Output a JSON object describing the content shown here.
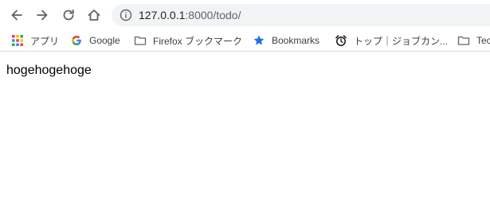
{
  "browser": {
    "address_bar": {
      "host": "127.0.0.1",
      "rest": ":8000/todo/"
    },
    "bookmarks": [
      {
        "label": "アプリ",
        "icon": "apps-grid-icon"
      },
      {
        "label": "Google",
        "icon": "google-g-icon"
      },
      {
        "label": "Firefox ブックマーク",
        "icon": "folder-icon"
      },
      {
        "label": "Bookmarks",
        "icon": "star-icon"
      },
      {
        "label": "トップ｜ジョブカン...",
        "icon": "alarm-clock-icon"
      },
      {
        "label": "Tec",
        "icon": "folder-icon"
      }
    ]
  },
  "page": {
    "text": "hogehogehoge"
  }
}
